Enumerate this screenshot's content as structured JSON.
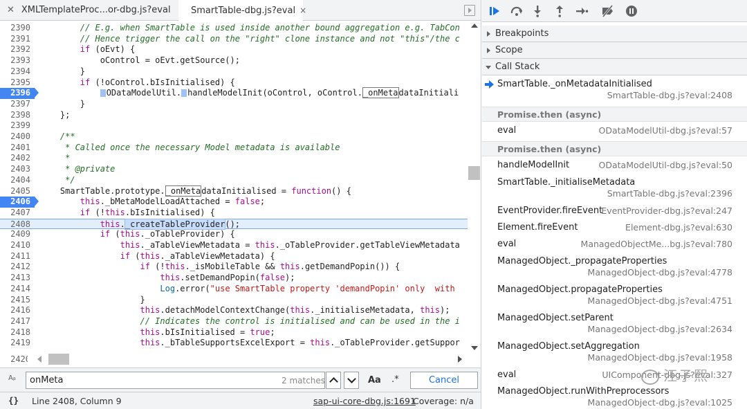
{
  "tabs": [
    {
      "label": "XMLTemplateProc...or-dbg.js?eval"
    },
    {
      "label": "SmartTable-dbg.js?eval",
      "close": "×"
    }
  ],
  "code": {
    "lines": [
      {
        "n": "2390",
        "html": "        <span class=\"cm\">// E.g. when SmartTable is used inside another bound aggregation e.g. TabCon</span>"
      },
      {
        "n": "2391",
        "html": "        <span class=\"cm\">// Hence trigger the call on the \"right\" clone instance and not \"this\"/the c</span>"
      },
      {
        "n": "2392",
        "html": "        <span class=\"kw\">if</span> (oEvt) {"
      },
      {
        "n": "2393",
        "html": "            oControl = oEvt.getSource();"
      },
      {
        "n": "2394",
        "html": "        }"
      },
      {
        "n": "2395",
        "html": "        <span class=\"kw\">if</span> (!oControl.bIsInitialised) {"
      },
      {
        "n": "2396",
        "bp": true,
        "html": "            <span class=\"mk\"></span>ODataModelUtil.<span class=\"mk\"></span>handleModelInit(oControl, oControl.<span class=\"box\">_onMeta</span>dataInitiali"
      },
      {
        "n": "2397",
        "html": "        }"
      },
      {
        "n": "2398",
        "html": "    };"
      },
      {
        "n": "2399",
        "html": ""
      },
      {
        "n": "2400",
        "html": "    <span class=\"cm\">/**</span>"
      },
      {
        "n": "2401",
        "html": "    <span class=\"cm\"> * Called once the necessary Model metadata is available</span>"
      },
      {
        "n": "2402",
        "html": "    <span class=\"cm\"> *</span>"
      },
      {
        "n": "2403",
        "html": "    <span class=\"cm\"> * @private</span>"
      },
      {
        "n": "2404",
        "html": "    <span class=\"cm\"> */</span>"
      },
      {
        "n": "2405",
        "html": "    SmartTable.prototype.<span class=\"box\">_onMeta</span>dataInitialised = <span class=\"kw\">function</span>() {"
      },
      {
        "n": "2406",
        "bp": true,
        "html": "        <span class=\"kw\">this</span>._bMetaModelLoadAttached = <span class=\"kw\">false</span>;"
      },
      {
        "n": "2407",
        "html": "        <span class=\"kw\">if</span> (!<span class=\"kw\">this</span>.bIsInitialised) {"
      },
      {
        "n": "2408",
        "exec": true,
        "html": "            <span class=\"kw\">this</span>.<span class=\"hl\">_createTableProvider</span>();"
      },
      {
        "n": "2409",
        "html": "            <span class=\"kw\">if</span> (<span class=\"kw\">this</span>._oTableProvider) {"
      },
      {
        "n": "2410",
        "html": "                <span class=\"kw\">this</span>._aTableViewMetadata = <span class=\"kw\">this</span>._oTableProvider.getTableViewMetadata"
      },
      {
        "n": "2411",
        "html": "                <span class=\"kw\">if</span> (<span class=\"kw\">this</span>._aTableViewMetadata) {"
      },
      {
        "n": "2412",
        "html": "                    <span class=\"kw\">if</span> (!<span class=\"kw\">this</span>._isMobileTable &amp;&amp; <span class=\"kw\">this</span>.getDemandPopin()) {"
      },
      {
        "n": "2413",
        "html": "                        <span class=\"kw\">this</span>.setDemandPopin(<span class=\"kw\">false</span>);"
      },
      {
        "n": "2414",
        "html": "                        <span class=\"ty\">Log</span>.error(<span class=\"str\">\"use SmartTable property 'demandPopin' only  with</span>"
      },
      {
        "n": "2415",
        "html": "                    }"
      },
      {
        "n": "2416",
        "html": "                    <span class=\"kw\">this</span>.detachModelContextChange(<span class=\"kw\">this</span>._initialiseMetadata, <span class=\"kw\">this</span>);"
      },
      {
        "n": "2417",
        "html": "                    <span class=\"cm\">// Indicates the control is initialised and can be used in the i</span>"
      },
      {
        "n": "2418",
        "html": "                    <span class=\"kw\">this</span>.bIsInitialised = <span class=\"kw\">true</span>;"
      },
      {
        "n": "2419",
        "html": "                    <span class=\"kw\">this</span>._bTableSupportsExcelExport = <span class=\"kw\">this</span>._oTableProvider.getSuppor"
      }
    ],
    "bottom_line": "2420"
  },
  "search": {
    "icon": "Aᵦ",
    "value": "onMeta",
    "matches": "2 matches",
    "case_label": "Aa",
    "regex_label": ".*",
    "cancel_label": "Cancel"
  },
  "status": {
    "brace": "{}",
    "position": "Line 2408, Column 9",
    "file": "sap-ui-core-dbg.js:1691",
    "coverage": "Coverage: n/a"
  },
  "sections": {
    "breakpoints": "Breakpoints",
    "scope": "Scope",
    "callstack": "Call Stack"
  },
  "frames": [
    {
      "type": "frame",
      "name": "SmartTable._onMetadataInitialised",
      "loc": "SmartTable-dbg.js?eval:2408",
      "two": true,
      "current": true
    },
    {
      "type": "async",
      "label": "Promise.then (async)"
    },
    {
      "type": "frame",
      "name": "eval",
      "loc": "ODataModelUtil-dbg.js?eval:57"
    },
    {
      "type": "async",
      "label": "Promise.then (async)"
    },
    {
      "type": "frame",
      "name": "handleModelInit",
      "loc": "ODataModelUtil-dbg.js?eval:50"
    },
    {
      "type": "frame",
      "name": "SmartTable._initialiseMetadata",
      "loc": "SmartTable-dbg.js?eval:2396",
      "two": true
    },
    {
      "type": "frame",
      "name": "EventProvider.fireEvent",
      "loc": "EventProvider-dbg.js?eval:247"
    },
    {
      "type": "frame",
      "name": "Element.fireEvent",
      "loc": "Element-dbg.js?eval:630"
    },
    {
      "type": "frame",
      "name": "eval",
      "loc": "ManagedObjectMe...bg.js?eval:780"
    },
    {
      "type": "frame",
      "name": "ManagedObject._propagateProperties",
      "loc": "ManagedObject-dbg.js?eval:4778",
      "two": true
    },
    {
      "type": "frame",
      "name": "ManagedObject.propagateProperties",
      "loc": "ManagedObject-dbg.js?eval:4751",
      "two": true
    },
    {
      "type": "frame",
      "name": "ManagedObject.setParent",
      "loc": "ManagedObject-dbg.js?eval:2634",
      "two": true
    },
    {
      "type": "frame",
      "name": "ManagedObject.setAggregation",
      "loc": "ManagedObject-dbg.js?eval:1958",
      "two": true
    },
    {
      "type": "frame",
      "name": "eval",
      "loc": "UIComponent-dbg.js?eval:327"
    },
    {
      "type": "frame",
      "name": "ManagedObject.runWithPreprocessors",
      "loc": "ManagedObject-dbg.js?eval:1025",
      "two": true
    }
  ],
  "watermark": "汪子熙",
  "colors": {
    "accent": "#1a73e8",
    "breakpoint": "#4285f4",
    "exec_line": "#e3eefc"
  }
}
